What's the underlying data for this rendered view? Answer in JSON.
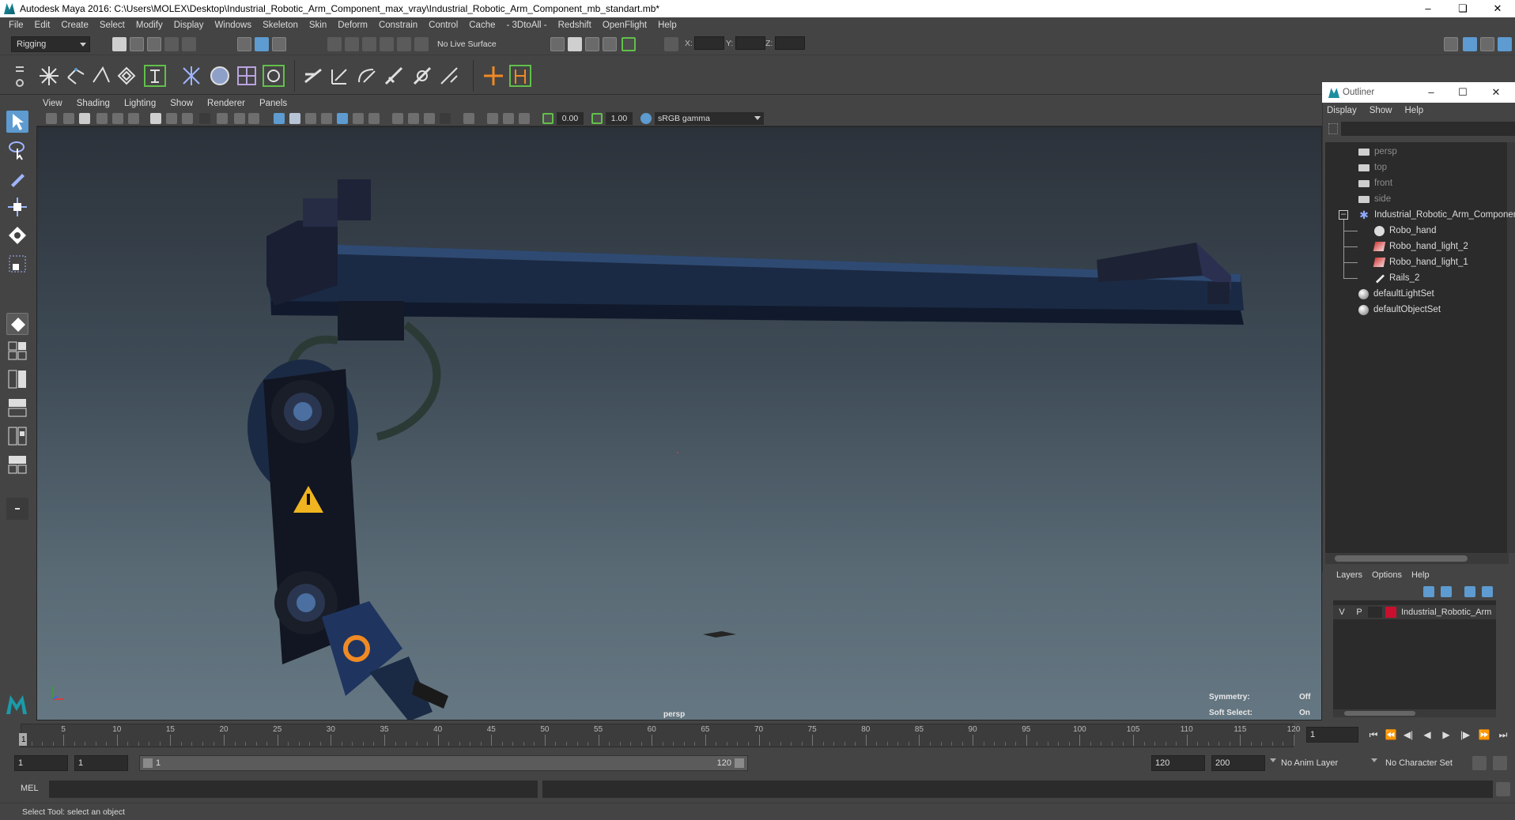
{
  "window": {
    "title": "Autodesk Maya 2016: C:\\Users\\MOLEX\\Desktop\\Industrial_Robotic_Arm_Component_max_vray\\Industrial_Robotic_Arm_Component_mb_standart.mb*",
    "controls": [
      "–",
      "❏",
      "✕"
    ]
  },
  "menubar": [
    "File",
    "Edit",
    "Create",
    "Select",
    "Modify",
    "Display",
    "Windows",
    "Skeleton",
    "Skin",
    "Deform",
    "Constrain",
    "Control",
    "Cache",
    "- 3DtoAll -",
    "Redshift",
    "OpenFlight",
    "Help"
  ],
  "statusline": {
    "menuset": "Rigging",
    "live_surface": "No Live Surface",
    "x_label": "X:",
    "y_label": "Y:",
    "z_label": "Z:"
  },
  "viewport": {
    "menu": [
      "View",
      "Shading",
      "Lighting",
      "Show",
      "Renderer",
      "Panels"
    ],
    "exposure": "0.00",
    "gamma": "1.00",
    "color_space": "sRGB gamma",
    "camera_label": "persp",
    "symmetry_label": "Symmetry:",
    "symmetry_value": "Off",
    "soft_select_label": "Soft Select:",
    "soft_select_value": "On"
  },
  "outliner": {
    "title": "Outliner",
    "menu": [
      "Display",
      "Show",
      "Help"
    ],
    "items": [
      {
        "label": "persp",
        "type": "camera",
        "greyed": true
      },
      {
        "label": "top",
        "type": "camera",
        "greyed": true
      },
      {
        "label": "front",
        "type": "camera",
        "greyed": true
      },
      {
        "label": "side",
        "type": "camera",
        "greyed": true
      },
      {
        "label": "Industrial_Robotic_Arm_Component",
        "type": "root"
      },
      {
        "label": "Robo_hand",
        "type": "transform"
      },
      {
        "label": "Robo_hand_light_2",
        "type": "light"
      },
      {
        "label": "Robo_hand_light_1",
        "type": "light"
      },
      {
        "label": "Rails_2",
        "type": "transform"
      },
      {
        "label": "defaultLightSet",
        "type": "set"
      },
      {
        "label": "defaultObjectSet",
        "type": "set"
      }
    ]
  },
  "layers": {
    "menu": [
      "Layers",
      "Options",
      "Help"
    ],
    "rows": [
      {
        "v": "V",
        "p": "P",
        "name": "Industrial_Robotic_Arm",
        "color": "#c8102e"
      }
    ]
  },
  "timeslider": {
    "ticks": [
      1,
      5,
      10,
      15,
      20,
      25,
      30,
      35,
      40,
      45,
      50,
      55,
      60,
      65,
      70,
      75,
      80,
      85,
      90,
      95,
      100,
      105,
      110,
      115,
      120
    ],
    "current_frame": "1",
    "current_field": "1"
  },
  "rangeslider": {
    "start": "1",
    "playback_start": "1",
    "range_start": "1",
    "range_end": "120",
    "playback_end": "120",
    "end": "200",
    "anim_layer": "No Anim Layer",
    "character_set": "No Character Set"
  },
  "cmdline": {
    "label": "MEL"
  },
  "helpline": {
    "text": "Select Tool: select an object"
  },
  "colors": {
    "accent_green": "#62c04a",
    "selection_blue": "#5d9bd0"
  }
}
